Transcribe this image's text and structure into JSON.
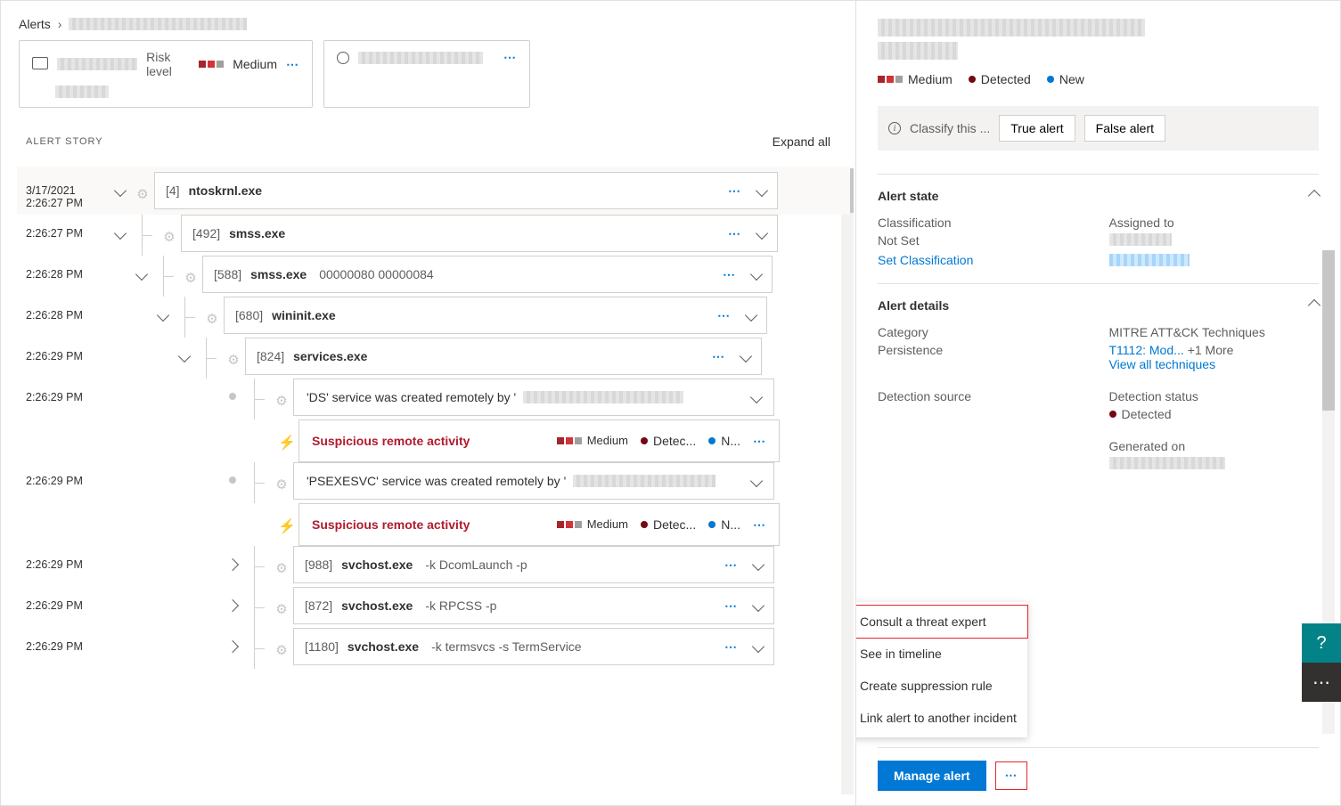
{
  "breadcrumb": {
    "root": "Alerts"
  },
  "device_card": {
    "risk_label": "Risk level",
    "risk_value": "Medium"
  },
  "story": {
    "title": "ALERT STORY",
    "expand": "Expand all",
    "rows": [
      {
        "ts_date": "3/17/2021",
        "ts_time": "2:26:27 PM",
        "pid": "[4]",
        "name": "ntoskrnl.exe",
        "args": "",
        "first": true
      },
      {
        "ts_time": "2:26:27 PM",
        "pid": "[492]",
        "name": "smss.exe",
        "args": ""
      },
      {
        "ts_time": "2:26:28 PM",
        "pid": "[588]",
        "name": "smss.exe",
        "args": "00000080 00000084"
      },
      {
        "ts_time": "2:26:28 PM",
        "pid": "[680]",
        "name": "wininit.exe",
        "args": ""
      },
      {
        "ts_time": "2:26:29 PM",
        "pid": "[824]",
        "name": "services.exe",
        "args": ""
      },
      {
        "ts_time": "2:26:29 PM",
        "event_prefix": "'DS' service was created remotely by '"
      },
      {
        "alert_title": "Suspicious remote activity",
        "sev": "Medium",
        "det": "Detec...",
        "nw": "N..."
      },
      {
        "ts_time": "2:26:29 PM",
        "event_prefix": "'PSEXESVC' service was created remotely by '"
      },
      {
        "alert_title": "Suspicious remote activity",
        "sev": "Medium",
        "det": "Detec...",
        "nw": "N..."
      },
      {
        "ts_time": "2:26:29 PM",
        "pid": "[988]",
        "name": "svchost.exe",
        "args": "-k DcomLaunch -p"
      },
      {
        "ts_time": "2:26:29 PM",
        "pid": "[872]",
        "name": "svchost.exe",
        "args": "-k RPCSS -p"
      },
      {
        "ts_time": "2:26:29 PM",
        "pid": "[1180]",
        "name": "svchost.exe",
        "args": "-k termsvcs -s TermService"
      }
    ]
  },
  "right": {
    "severity": "Medium",
    "status": "Detected",
    "state": "New",
    "classify_prompt": "Classify this ...",
    "true_alert": "True alert",
    "false_alert": "False alert",
    "alert_state_title": "Alert state",
    "classification_label": "Classification",
    "classification_value": "Not Set",
    "set_classification": "Set Classification",
    "assigned_label": "Assigned to",
    "alert_details_title": "Alert details",
    "category_label": "Category",
    "category_value": "Persistence",
    "mitre_label": "MITRE ATT&CK Techniques",
    "mitre_link": "T1112: Mod...",
    "mitre_more": "+1 More",
    "mitre_view": "View all techniques",
    "det_source": "Detection source",
    "det_status_label": "Detection status",
    "det_status_value": "Detected",
    "generated_label": "Generated on",
    "manage": "Manage alert",
    "menu": {
      "consult": "Consult a threat expert",
      "timeline": "See in timeline",
      "suppress": "Create suppression rule",
      "link": "Link alert to another incident"
    }
  }
}
